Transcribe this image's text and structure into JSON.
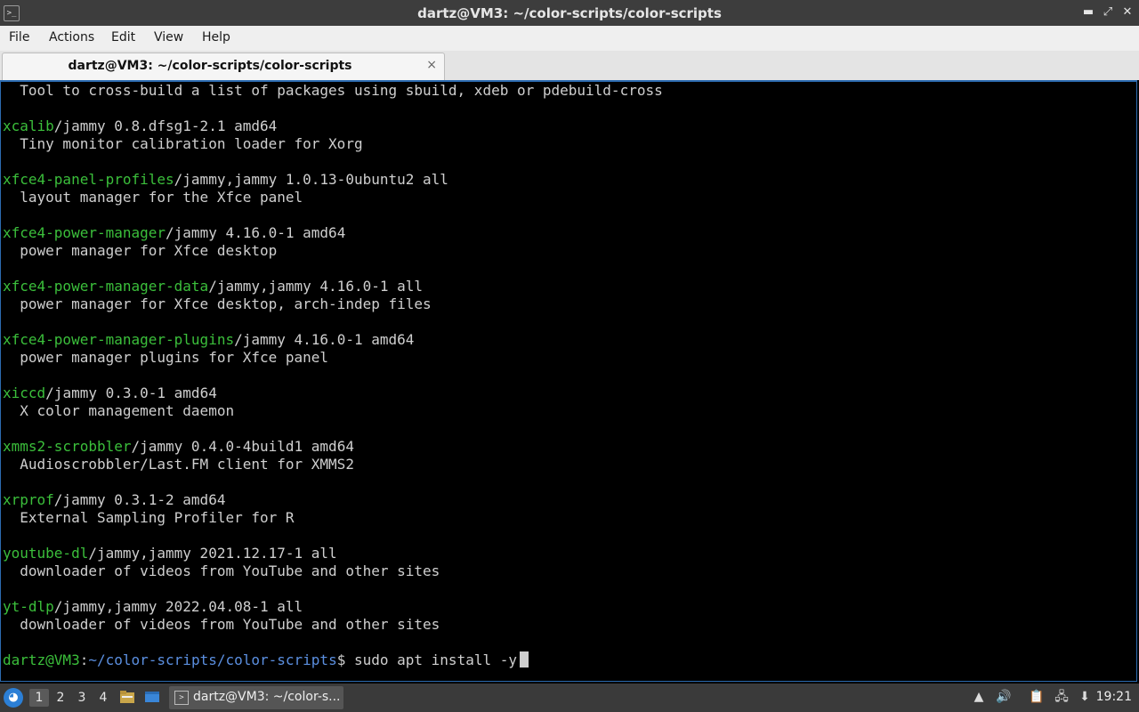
{
  "window": {
    "title": "dartz@VM3: ~/color-scripts/color-scripts",
    "controls": {
      "minimize": "▬",
      "maximize": "⤢",
      "close": "✕"
    }
  },
  "menubar": [
    "File",
    "Actions",
    "Edit",
    "View",
    "Help"
  ],
  "tab": {
    "label": "dartz@VM3: ~/color-scripts/color-scripts",
    "close": "×"
  },
  "terminal": {
    "lines": [
      {
        "pkg": "",
        "rest": "  Tool to cross-build a list of packages using sbuild, xdeb or pdebuild-cross"
      },
      {
        "pkg": "",
        "rest": ""
      },
      {
        "pkg": "xcalib",
        "rest": "/jammy 0.8.dfsg1-2.1 amd64"
      },
      {
        "pkg": "",
        "rest": "  Tiny monitor calibration loader for Xorg"
      },
      {
        "pkg": "",
        "rest": ""
      },
      {
        "pkg": "xfce4-panel-profiles",
        "rest": "/jammy,jammy 1.0.13-0ubuntu2 all"
      },
      {
        "pkg": "",
        "rest": "  layout manager for the Xfce panel"
      },
      {
        "pkg": "",
        "rest": ""
      },
      {
        "pkg": "xfce4-power-manager",
        "rest": "/jammy 4.16.0-1 amd64"
      },
      {
        "pkg": "",
        "rest": "  power manager for Xfce desktop"
      },
      {
        "pkg": "",
        "rest": ""
      },
      {
        "pkg": "xfce4-power-manager-data",
        "rest": "/jammy,jammy 4.16.0-1 all"
      },
      {
        "pkg": "",
        "rest": "  power manager for Xfce desktop, arch-indep files"
      },
      {
        "pkg": "",
        "rest": ""
      },
      {
        "pkg": "xfce4-power-manager-plugins",
        "rest": "/jammy 4.16.0-1 amd64"
      },
      {
        "pkg": "",
        "rest": "  power manager plugins for Xfce panel"
      },
      {
        "pkg": "",
        "rest": ""
      },
      {
        "pkg": "xiccd",
        "rest": "/jammy 0.3.0-1 amd64"
      },
      {
        "pkg": "",
        "rest": "  X color management daemon"
      },
      {
        "pkg": "",
        "rest": ""
      },
      {
        "pkg": "xmms2-scrobbler",
        "rest": "/jammy 0.4.0-4build1 amd64"
      },
      {
        "pkg": "",
        "rest": "  Audioscrobbler/Last.FM client for XMMS2"
      },
      {
        "pkg": "",
        "rest": ""
      },
      {
        "pkg": "xrprof",
        "rest": "/jammy 0.3.1-2 amd64"
      },
      {
        "pkg": "",
        "rest": "  External Sampling Profiler for R"
      },
      {
        "pkg": "",
        "rest": ""
      },
      {
        "pkg": "youtube-dl",
        "rest": "/jammy,jammy 2021.12.17-1 all"
      },
      {
        "pkg": "",
        "rest": "  downloader of videos from YouTube and other sites"
      },
      {
        "pkg": "",
        "rest": ""
      },
      {
        "pkg": "yt-dlp",
        "rest": "/jammy,jammy 2022.04.08-1 all"
      },
      {
        "pkg": "",
        "rest": "  downloader of videos from YouTube and other sites"
      },
      {
        "pkg": "",
        "rest": ""
      }
    ],
    "prompt": {
      "user": "dartz@VM3",
      "sep": ":",
      "path": "~/color-scripts/color-scripts",
      "symbol": "$ ",
      "command": "sudo apt install -y"
    }
  },
  "taskbar": {
    "workspaces": [
      "1",
      "2",
      "3",
      "4"
    ],
    "active_workspace": "1",
    "task_label": "dartz@VM3: ~/color-s...",
    "clock": "19:21"
  },
  "colors": {
    "package_green": "#3bbf3b",
    "prompt_path_blue": "#5b8fe0",
    "terminal_text": "#cfcfcf",
    "accent_border": "#2c6bb0"
  }
}
